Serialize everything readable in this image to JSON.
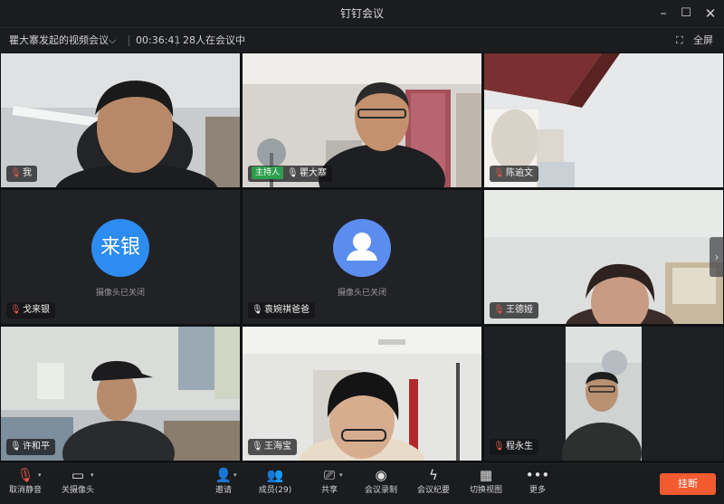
{
  "window": {
    "title": "钉钉会议",
    "min_glyph": "–",
    "max_glyph": "☐",
    "close_glyph": "✕"
  },
  "infobar": {
    "topic": "瞿大寨发起的视频会议",
    "timer": "00:36:41",
    "participants_text": "28人在会议中",
    "fullscreen_label": "全屏"
  },
  "tiles": [
    {
      "name": "我",
      "mic": "muted",
      "camera": "on"
    },
    {
      "name": "瞿大寨",
      "mic": "on",
      "camera": "on",
      "host_label": "主持人"
    },
    {
      "name": "陈逾文",
      "mic": "muted",
      "camera": "on"
    },
    {
      "name": "戈来银",
      "mic": "muted",
      "camera": "off",
      "avatar_text": "来银",
      "camera_off_text": "摄像头已关闭"
    },
    {
      "name": "袁婉祺爸爸",
      "mic": "on",
      "camera": "off",
      "avatar_text": "",
      "camera_off_text": "摄像头已关闭"
    },
    {
      "name": "王德娅",
      "mic": "muted",
      "camera": "on"
    },
    {
      "name": "许和平",
      "mic": "on",
      "camera": "on"
    },
    {
      "name": "王海宝",
      "mic": "on",
      "camera": "on"
    },
    {
      "name": "程永生",
      "mic": "muted",
      "camera": "on"
    }
  ],
  "toolbar": {
    "unmute_label": "取消静音",
    "camera_off_label": "关摄像头",
    "invite_label": "邀请",
    "members_label": "成员(29)",
    "share_label": "共享",
    "record_label": "会议录制",
    "minutes_label": "会议纪要",
    "layout_label": "切换视图",
    "more_label": "更多",
    "end_label": "挂断"
  },
  "colors": {
    "end_button": "#f25a30",
    "host_tag": "#2e9e4d",
    "muted_mic": "#e05a47",
    "avatar": "#2d8cf0"
  }
}
